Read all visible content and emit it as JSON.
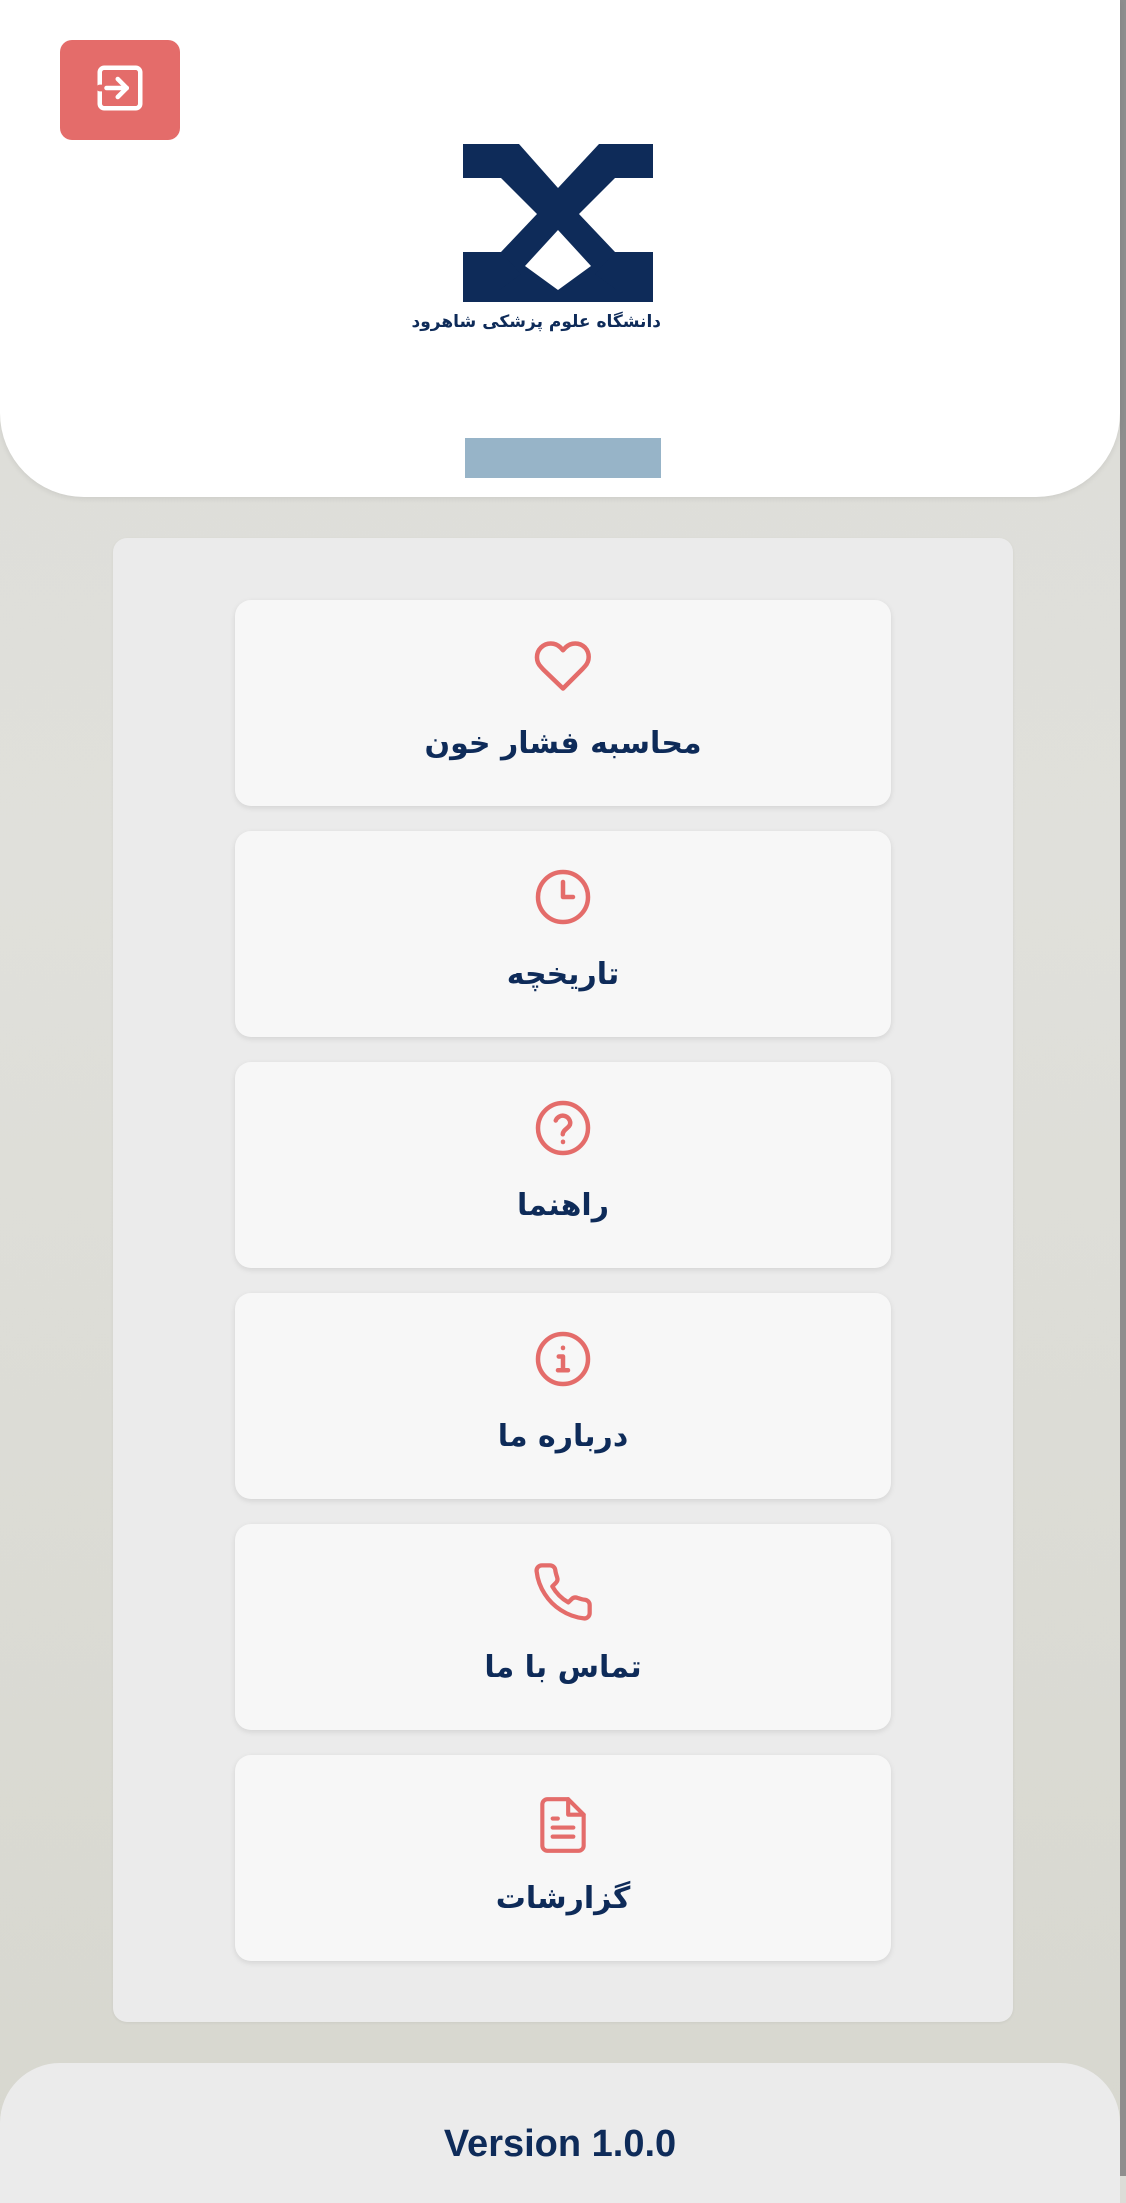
{
  "header": {
    "logout_icon": "logout-icon",
    "logo_text": "دانشگاه علوم پزشکی شاهرود",
    "colors": {
      "accent": "#e46c6a",
      "brand": "#0e2b59",
      "bar": "#97b4c8"
    }
  },
  "menu": {
    "items": [
      {
        "label": "محاسبه فشار خون",
        "icon": "heart-icon"
      },
      {
        "label": "تاریخچه",
        "icon": "clock-icon"
      },
      {
        "label": "راهنما",
        "icon": "help-circle-icon"
      },
      {
        "label": "درباره ما",
        "icon": "info-circle-icon"
      },
      {
        "label": "تماس با ما",
        "icon": "phone-icon"
      },
      {
        "label": "گزارشات",
        "icon": "document-icon"
      }
    ]
  },
  "footer": {
    "version": "Version 1.0.0"
  }
}
